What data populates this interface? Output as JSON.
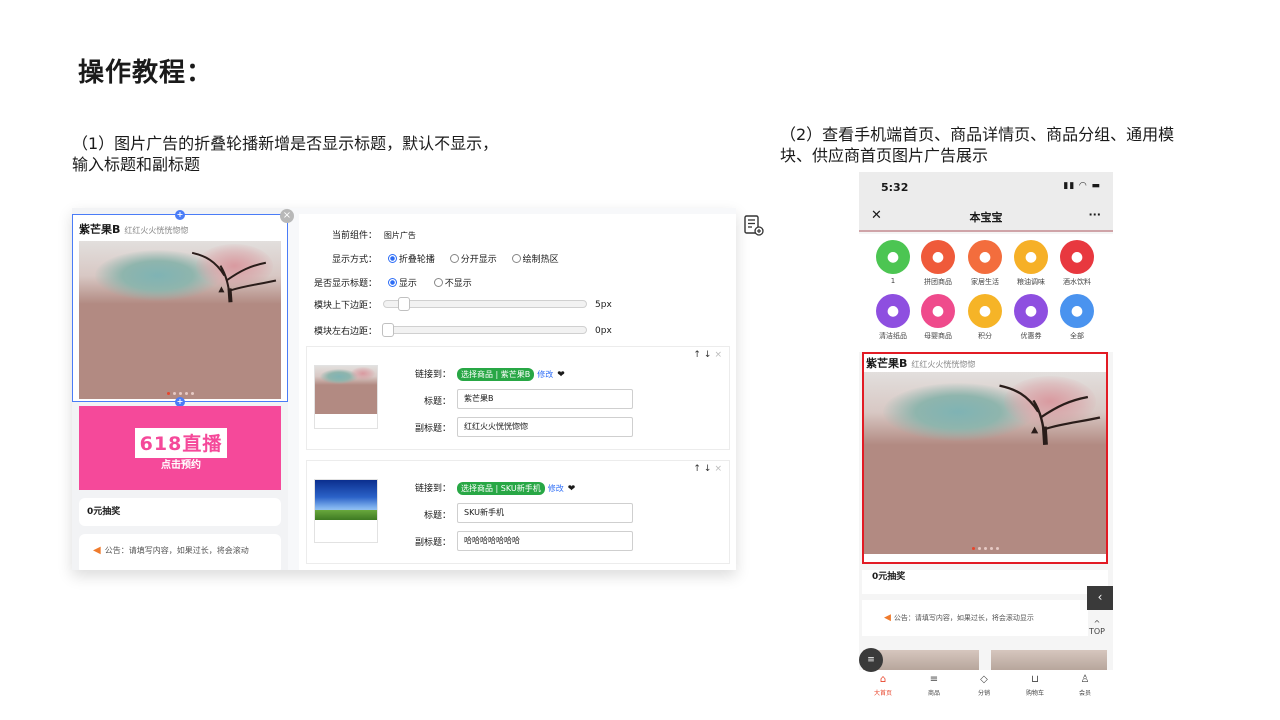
{
  "page": {
    "title": "操作教程：",
    "step1": "（1）图片广告的折叠轮播新增是否显示标题，默认不显示，输入标题和副标题",
    "step2": "（2）查看手机端首页、商品详情页、商品分组、通用模块、供应商首页图片广告展示"
  },
  "editor": {
    "preview": {
      "ad_title": "紫芒果B",
      "ad_subtitle": "红红火火恍恍惚惚",
      "live_title": "618直播",
      "live_sub": "点击预约",
      "lottery": "0元抽奖",
      "notice": "公告：请填写内容，如果过长，将会滚动"
    },
    "props": {
      "component_label": "当前组件：",
      "component_value": "图片广告",
      "display_label": "显示方式：",
      "display_options": [
        "折叠轮播",
        "分开显示",
        "绘制热区"
      ],
      "show_title_label": "是否显示标题：",
      "show_title_options": [
        "显示",
        "不显示"
      ],
      "vmargin_label": "模块上下边距：",
      "vmargin_value": "5px",
      "hmargin_label": "模块左右边距：",
      "hmargin_value": "0px"
    },
    "cards": [
      {
        "link_label": "链接到：",
        "link_tag": "选择商品 | 紫芒果B",
        "edit": "修改",
        "title_label": "标题：",
        "title_value": "紫芒果B",
        "subtitle_label": "副标题：",
        "subtitle_value": "红红火火恍恍惚惚"
      },
      {
        "link_label": "链接到：",
        "link_tag": "选择商品 | SKU新手机",
        "edit": "修改",
        "title_label": "标题：",
        "title_value": "SKU新手机",
        "subtitle_label": "副标题：",
        "subtitle_value": "哈哈哈哈哈哈哈"
      }
    ]
  },
  "phone": {
    "time": "5:32",
    "nav_title": "本宝宝",
    "grid": [
      {
        "label": "1",
        "color": "#4cc552",
        "icon": "apple-icon"
      },
      {
        "label": "拼团商品",
        "color": "#ef5a3a",
        "icon": "cup-icon"
      },
      {
        "label": "家居生活",
        "color": "#f36d3d",
        "icon": "sofa-icon"
      },
      {
        "label": "粮油调味",
        "color": "#f6b027",
        "icon": "bowl-icon"
      },
      {
        "label": "酒水饮料",
        "color": "#e8383f",
        "icon": "bottle-icon"
      },
      {
        "label": "清洁纸品",
        "color": "#8e4fe0",
        "icon": "tissue-icon"
      },
      {
        "label": "母婴商品",
        "color": "#ef4b8c",
        "icon": "baby-bottle-icon"
      },
      {
        "label": "积分",
        "color": "#f6b427",
        "icon": "gift-icon"
      },
      {
        "label": "优惠券",
        "color": "#8e4fe0",
        "icon": "coupon-icon"
      },
      {
        "label": "全部",
        "color": "#4a93ef",
        "icon": "grid-icon"
      }
    ],
    "ad_title": "紫芒果B",
    "ad_subtitle": "红红火火恍恍惚惚",
    "lottery": "0元抽奖",
    "notice": "公告：请填写内容，如果过长，将会滚动显示",
    "top_label": "TOP",
    "tabs": [
      "大首页",
      "商品",
      "分销",
      "购物车",
      "会员"
    ]
  }
}
